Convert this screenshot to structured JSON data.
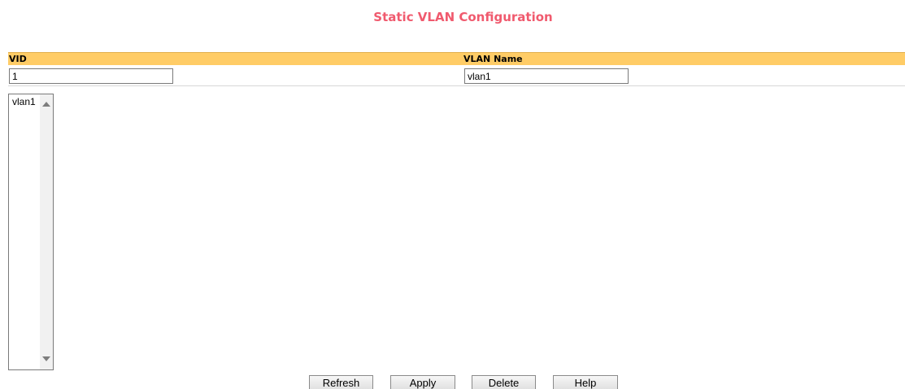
{
  "page": {
    "title": "Static VLAN Configuration"
  },
  "table": {
    "headers": {
      "vid": "VID",
      "vlan_name": "VLAN Name"
    },
    "fields": {
      "vid_value": "1",
      "vlan_name_value": "vlan1"
    }
  },
  "vlan_list": {
    "items": [
      "vlan1"
    ]
  },
  "buttons": {
    "refresh": "Refresh",
    "apply": "Apply",
    "delete": "Delete",
    "help": "Help"
  },
  "colors": {
    "title": "#f05a6e",
    "header_bar": "#ffcc66"
  },
  "icons": {
    "scroll_up": "triangle-up-icon",
    "scroll_down": "triangle-down-icon"
  }
}
